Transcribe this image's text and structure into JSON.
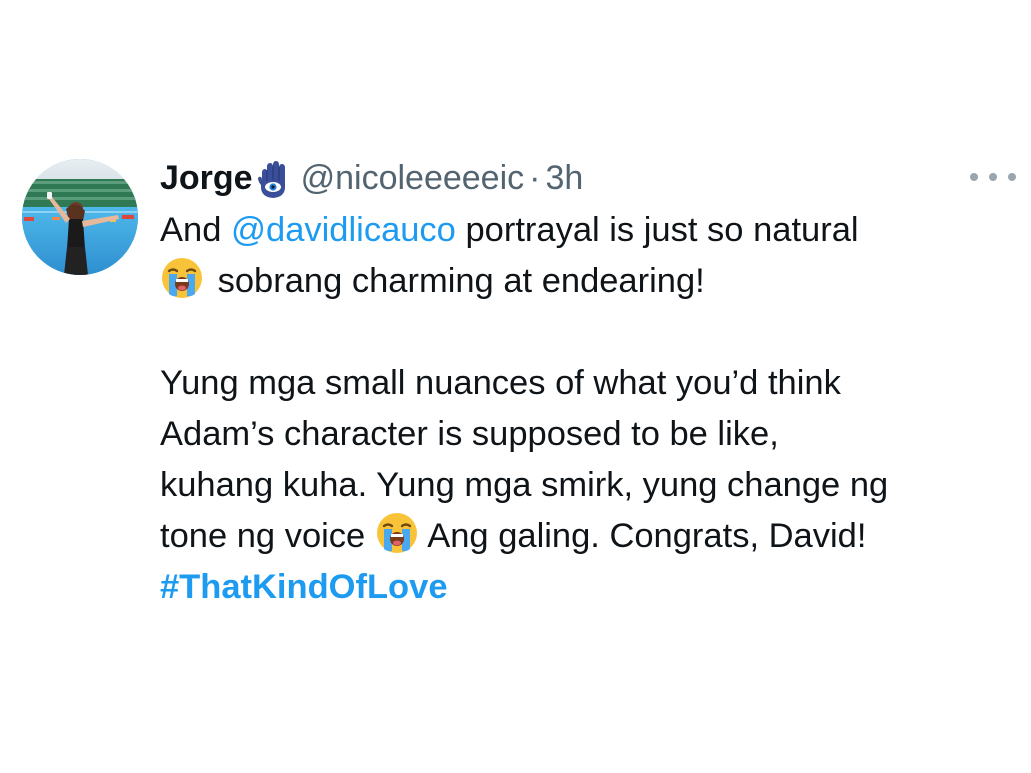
{
  "tweet": {
    "author_name": "Jorge",
    "name_badge_icon": "hamsa-hand-icon",
    "handle": "@nicoleeeeeic",
    "separator": "·",
    "time": "3h",
    "more_icon": "more-options-icon",
    "line1_prefix": "And ",
    "mention": "@davidlicauco",
    "line1_suffix": " portrayal is just so natural",
    "emoji_name": "loudly-crying-face-icon",
    "line2": "sobrang charming at endearing!",
    "line3": "Yung mga small nuances of what you’d think",
    "line4": "Adam’s character is supposed to be like,",
    "line5": "kuhang kuha. Yung mga smirk, yung change ng",
    "line6_prefix": "tone ng voice",
    "line6_suffix": "Ang galing. Congrats, David!",
    "hashtag": "#ThatKindOfLove",
    "colors": {
      "link": "#1d9bf0",
      "text": "#0f1419",
      "muted": "#536471"
    }
  }
}
